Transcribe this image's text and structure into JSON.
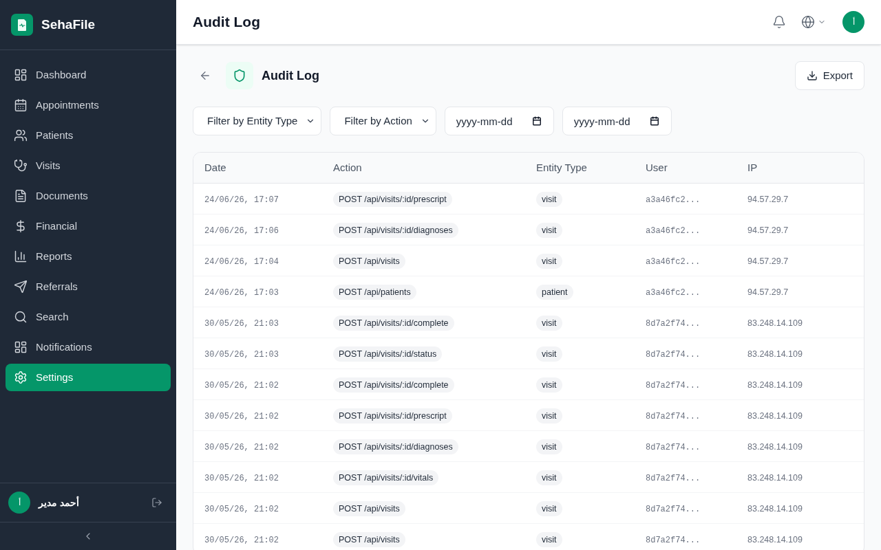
{
  "sidebar": {
    "brand": "SehaFile",
    "items": [
      {
        "label": "Dashboard",
        "selected": false
      },
      {
        "label": "Appointments",
        "selected": false
      },
      {
        "label": "Patients",
        "selected": false
      },
      {
        "label": "Visits",
        "selected": false
      },
      {
        "label": "Documents",
        "selected": false
      },
      {
        "label": "Financial",
        "selected": false
      },
      {
        "label": "Reports",
        "selected": false
      },
      {
        "label": "Referrals",
        "selected": false
      },
      {
        "label": "Search",
        "selected": false
      },
      {
        "label": "Notifications",
        "selected": false
      },
      {
        "label": "Settings",
        "selected": true
      }
    ],
    "user": {
      "avatar_initial": "أ",
      "name": "أحمد مدير"
    }
  },
  "header": {
    "title": "Audit Log",
    "avatar_initial": "أ"
  },
  "page": {
    "title": "Audit Log",
    "export_button": "Export",
    "filters": [
      {
        "kind": "select",
        "value": "Filter by Entity Type"
      },
      {
        "kind": "select",
        "value": "Filter by Action"
      },
      {
        "kind": "date",
        "placeholder": "yyyy-mm-dd"
      },
      {
        "kind": "date",
        "placeholder": "yyyy-mm-dd"
      }
    ]
  },
  "table": {
    "columns": [
      "Date",
      "Action",
      "Entity Type",
      "User",
      "IP"
    ],
    "rows": [
      {
        "date": "24/06/26, 17:07",
        "action": "POST /api/visits/:id/prescript",
        "entity_type": "visit",
        "user": "a3a46fc2...",
        "ip": "94.57.29.7"
      },
      {
        "date": "24/06/26, 17:06",
        "action": "POST /api/visits/:id/diagnoses",
        "entity_type": "visit",
        "user": "a3a46fc2...",
        "ip": "94.57.29.7"
      },
      {
        "date": "24/06/26, 17:04",
        "action": "POST /api/visits",
        "entity_type": "visit",
        "user": "a3a46fc2...",
        "ip": "94.57.29.7"
      },
      {
        "date": "24/06/26, 17:03",
        "action": "POST /api/patients",
        "entity_type": "patient",
        "user": "a3a46fc2...",
        "ip": "94.57.29.7"
      },
      {
        "date": "30/05/26, 21:03",
        "action": "POST /api/visits/:id/complete",
        "entity_type": "visit",
        "user": "8d7a2f74...",
        "ip": "83.248.14.109"
      },
      {
        "date": "30/05/26, 21:03",
        "action": "POST /api/visits/:id/status",
        "entity_type": "visit",
        "user": "8d7a2f74...",
        "ip": "83.248.14.109"
      },
      {
        "date": "30/05/26, 21:02",
        "action": "POST /api/visits/:id/complete",
        "entity_type": "visit",
        "user": "8d7a2f74...",
        "ip": "83.248.14.109"
      },
      {
        "date": "30/05/26, 21:02",
        "action": "POST /api/visits/:id/prescript",
        "entity_type": "visit",
        "user": "8d7a2f74...",
        "ip": "83.248.14.109"
      },
      {
        "date": "30/05/26, 21:02",
        "action": "POST /api/visits/:id/diagnoses",
        "entity_type": "visit",
        "user": "8d7a2f74...",
        "ip": "83.248.14.109"
      },
      {
        "date": "30/05/26, 21:02",
        "action": "POST /api/visits/:id/vitals",
        "entity_type": "visit",
        "user": "8d7a2f74...",
        "ip": "83.248.14.109"
      },
      {
        "date": "30/05/26, 21:02",
        "action": "POST /api/visits",
        "entity_type": "visit",
        "user": "8d7a2f74...",
        "ip": "83.248.14.109"
      },
      {
        "date": "30/05/26, 21:02",
        "action": "POST /api/visits",
        "entity_type": "visit",
        "user": "8d7a2f74...",
        "ip": "83.248.14.109"
      }
    ]
  }
}
